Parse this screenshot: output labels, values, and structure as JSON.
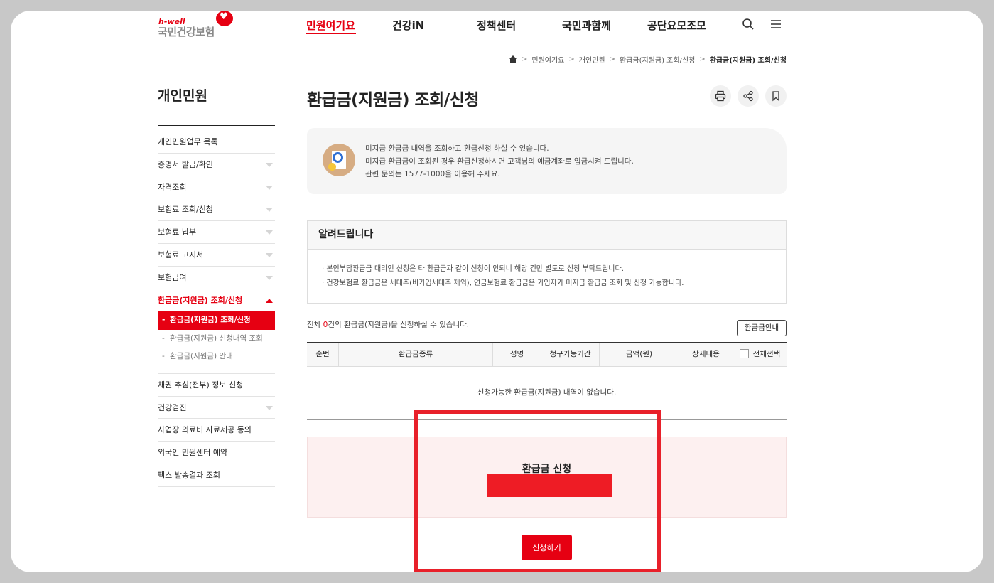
{
  "logo": {
    "sub": "h-well",
    "main": "국민건강보험"
  },
  "gnb": [
    "민원여기요",
    "건강iN",
    "정책센터",
    "국민과함께",
    "공단요모조모"
  ],
  "header_icons": [
    "search-icon",
    "menu-icon"
  ],
  "breadcrumb": [
    "민원여기요",
    "개인민원",
    "환급금(지원금) 조회/신청",
    "환급금(지원금) 조회/신청"
  ],
  "sidebar": {
    "title": "개인민원",
    "items": [
      "개인민원업무 목록",
      "증명서 발급/확인",
      "자격조회",
      "보험료 조회/신청",
      "보험료 납부",
      "보험료 고지서",
      "보험급여",
      "환급금(지원금) 조회/신청"
    ],
    "sub_items": [
      "환급금(지원금) 조회/신청",
      "환급금(지원금) 신청내역 조회",
      "환급금(지원금) 안내"
    ],
    "items_after": [
      "채권 추심(전부) 정보 신청",
      "건강검진",
      "사업장 의료비 자료제공 동의",
      "외국인 민원센터 예약",
      "팩스 발송결과 조회"
    ]
  },
  "page": {
    "title": "환급금(지원금) 조회/신청",
    "actions": [
      "print-icon",
      "share-icon",
      "bookmark-icon"
    ]
  },
  "info": {
    "lines": [
      "미지급 환급금 내역을 조회하고 환급신청 하실 수 있습니다.",
      "미지급 환급금이 조회된 경우 환급신청하시면 고객님의 예금계좌로 입금시켜 드립니다.",
      "관련 문의는 1577-1000을 이용해 주세요."
    ]
  },
  "notice": {
    "title": "알려드립니다",
    "items": [
      "본인부담환급금 대리인 신청은 타 환급금과 같이 신청이 안되니 해당 건만 별도로 신청 부탁드립니다.",
      "건강보험료 환급금은 세대주(비가입세대주 제외), 연금보험료 환급금은 가입자가 미지급 환급금 조회 및 신청 가능합니다."
    ]
  },
  "summary": {
    "prefix": "전체 ",
    "count": "0",
    "suffix": "건의 환급금(지원금)을 신청하실 수 있습니다."
  },
  "guide_button": "환급금안내",
  "table": {
    "headers": [
      "순번",
      "환급금종류",
      "성명",
      "청구가능기간",
      "금액(원)",
      "상세내용",
      "전체선택"
    ],
    "empty_message": "신청가능한 환급금(지원금) 내역이 없습니다."
  },
  "apply": {
    "title": "환급금 신청",
    "button": "신청하기"
  },
  "colors": {
    "accent": "#e60012",
    "highlight": "#e8202a"
  }
}
